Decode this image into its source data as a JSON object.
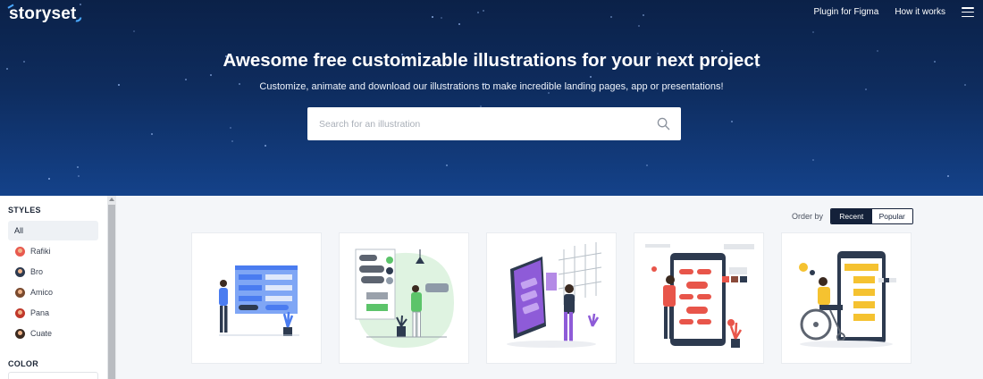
{
  "header": {
    "logo": "storyset",
    "nav": [
      "Plugin for Figma",
      "How it works"
    ],
    "menu_icon": "hamburger-icon"
  },
  "hero": {
    "title": "Awesome free customizable illustrations for your next project",
    "subtitle": "Customize, animate and download our illustrations to make incredible landing pages, app or presentations!",
    "search_placeholder": "Search for an illustration",
    "search_icon": "search-icon"
  },
  "sidebar": {
    "styles_label": "STYLES",
    "all_label": "All",
    "styles": [
      {
        "label": "Rafiki",
        "color": "#e85a4f"
      },
      {
        "label": "Bro",
        "color": "#2d3a4f"
      },
      {
        "label": "Amico",
        "color": "#7a4a2e"
      },
      {
        "label": "Pana",
        "color": "#c0392b"
      },
      {
        "label": "Cuate",
        "color": "#3b2a20"
      }
    ],
    "color_label": "COLOR"
  },
  "main": {
    "order_by_label": "Order by",
    "order_options": [
      "Recent",
      "Popular"
    ],
    "selected_order": "Recent"
  },
  "colors": {
    "accent_blue": "#4a7cf0",
    "accent_green": "#5cc46a",
    "accent_purple": "#8e5bd8",
    "accent_red": "#e8554a",
    "accent_yellow": "#f5c230",
    "navy": "#14213a"
  }
}
